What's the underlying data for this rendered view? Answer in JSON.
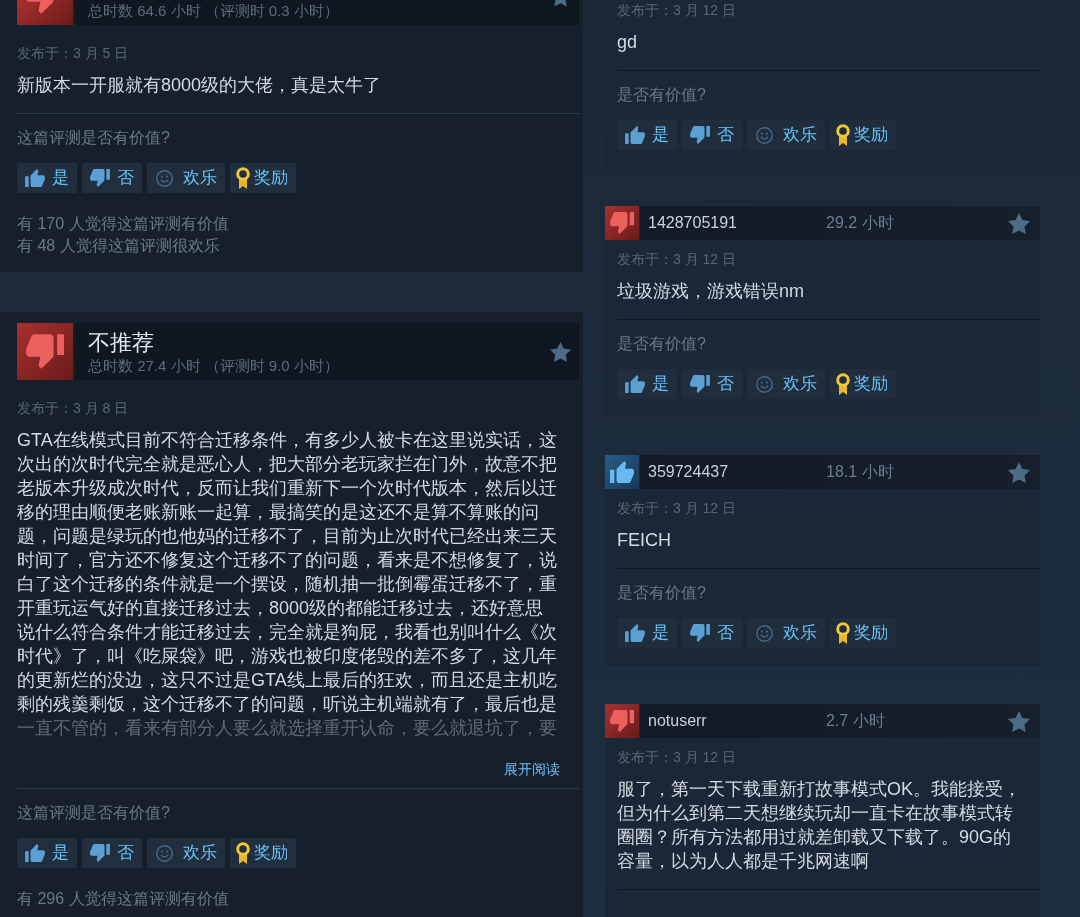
{
  "left_column": {
    "reviews": [
      {
        "recommended": false,
        "playtime": "总时数 64.6 小时 （评测时 0.3 小时）",
        "posted": "发布于：3 月 5 日",
        "body": "新版本一开服就有8000级的大佬，真是太牛了",
        "helpful_prompt": "这篇评测是否有价值?",
        "buttons": [
          {
            "kind": "yes",
            "label": "是"
          },
          {
            "kind": "no",
            "label": "否"
          },
          {
            "kind": "funny",
            "label": "欢乐"
          },
          {
            "kind": "award",
            "label": "奖励"
          }
        ],
        "stats": [
          "有 170 人觉得这篇评测有价值",
          "有 48 人觉得这篇评测很欢乐"
        ]
      },
      {
        "recommended": false,
        "title": "不推荐",
        "playtime": "总时数 27.4 小时 （评测时 9.0 小时）",
        "posted": "发布于：3 月 8 日",
        "body": "GTA在线模式目前不符合迁移条件，有多少人被卡在这里说实话，这次出的次时代完全就是恶心人，把大部分老玩家拦在门外，故意不把老版本升级成次时代，反而让我们重新下一个次时代版本，然后以迁移的理由顺便老账新账一起算，最搞笑的是这还不是算不算账的问题，问题是绿玩的也他妈的迁移不了，目前为止次时代已经出来三天时间了，官方还不修复这个迁移不了的问题，看来是不想修复了，说白了这个迁移的条件就是一个摆设，随机抽一批倒霉蛋迁移不了，重开重玩运气好的直接迁移过去，8000级的都能迁移过去，还好意思说什么符合条件才能迁移过去，完全就是狗屁，我看也别叫什么《次时代》了，叫《吃屎袋》吧，游戏也被印度佬毁的差不多了，这几年的更新烂的没边，这只不过是GTA线上最后的狂欢，而且还是主机吃剩的残羹剩饭，这个迁移不了的问题，听说主机端就有了，最后也是一直不管的，看来有部分人要么就选择重开认命，要么就退坑了，要",
        "read_more": "展开阅读",
        "helpful_prompt": "这篇评测是否有价值?",
        "buttons": [
          {
            "kind": "yes",
            "label": "是"
          },
          {
            "kind": "no",
            "label": "否"
          },
          {
            "kind": "funny",
            "label": "欢乐"
          },
          {
            "kind": "award",
            "label": "奖励"
          }
        ],
        "stats": [
          "有 296 人觉得这篇评测有价值"
        ]
      }
    ]
  },
  "right_column": {
    "reviews": [
      {
        "posted": "发布于：3 月 12 日",
        "body": "gd",
        "helpful_prompt": "是否有价值?",
        "buttons": [
          {
            "kind": "yes",
            "label": "是"
          },
          {
            "kind": "no",
            "label": "否"
          },
          {
            "kind": "funny",
            "label": "欢乐"
          },
          {
            "kind": "award",
            "label": "奖励"
          }
        ]
      },
      {
        "recommended": false,
        "user": "1428705191",
        "hours": "29.2 小时",
        "posted": "发布于：3 月 12 日",
        "body": "垃圾游戏，游戏错误nm",
        "helpful_prompt": "是否有价值?",
        "buttons": [
          {
            "kind": "yes",
            "label": "是"
          },
          {
            "kind": "no",
            "label": "否"
          },
          {
            "kind": "funny",
            "label": "欢乐"
          },
          {
            "kind": "award",
            "label": "奖励"
          }
        ]
      },
      {
        "recommended": true,
        "user": "359724437",
        "hours": "18.1 小时",
        "posted": "发布于：3 月 12 日",
        "body": "FEICH",
        "helpful_prompt": "是否有价值?",
        "buttons": [
          {
            "kind": "yes",
            "label": "是"
          },
          {
            "kind": "no",
            "label": "否"
          },
          {
            "kind": "funny",
            "label": "欢乐"
          },
          {
            "kind": "award",
            "label": "奖励"
          }
        ]
      },
      {
        "recommended": false,
        "user": "notuserr",
        "hours": "2.7 小时",
        "posted": "发布于：3 月 12 日",
        "body": "服了，第一天下载重新打故事模式OK。我能接受，但为什么到第二天想继续玩却一直卡在故事模式转圈圈？所有方法都用过就差卸载又下载了。90G的容量，以为人人都是千兆网速啊"
      }
    ]
  }
}
